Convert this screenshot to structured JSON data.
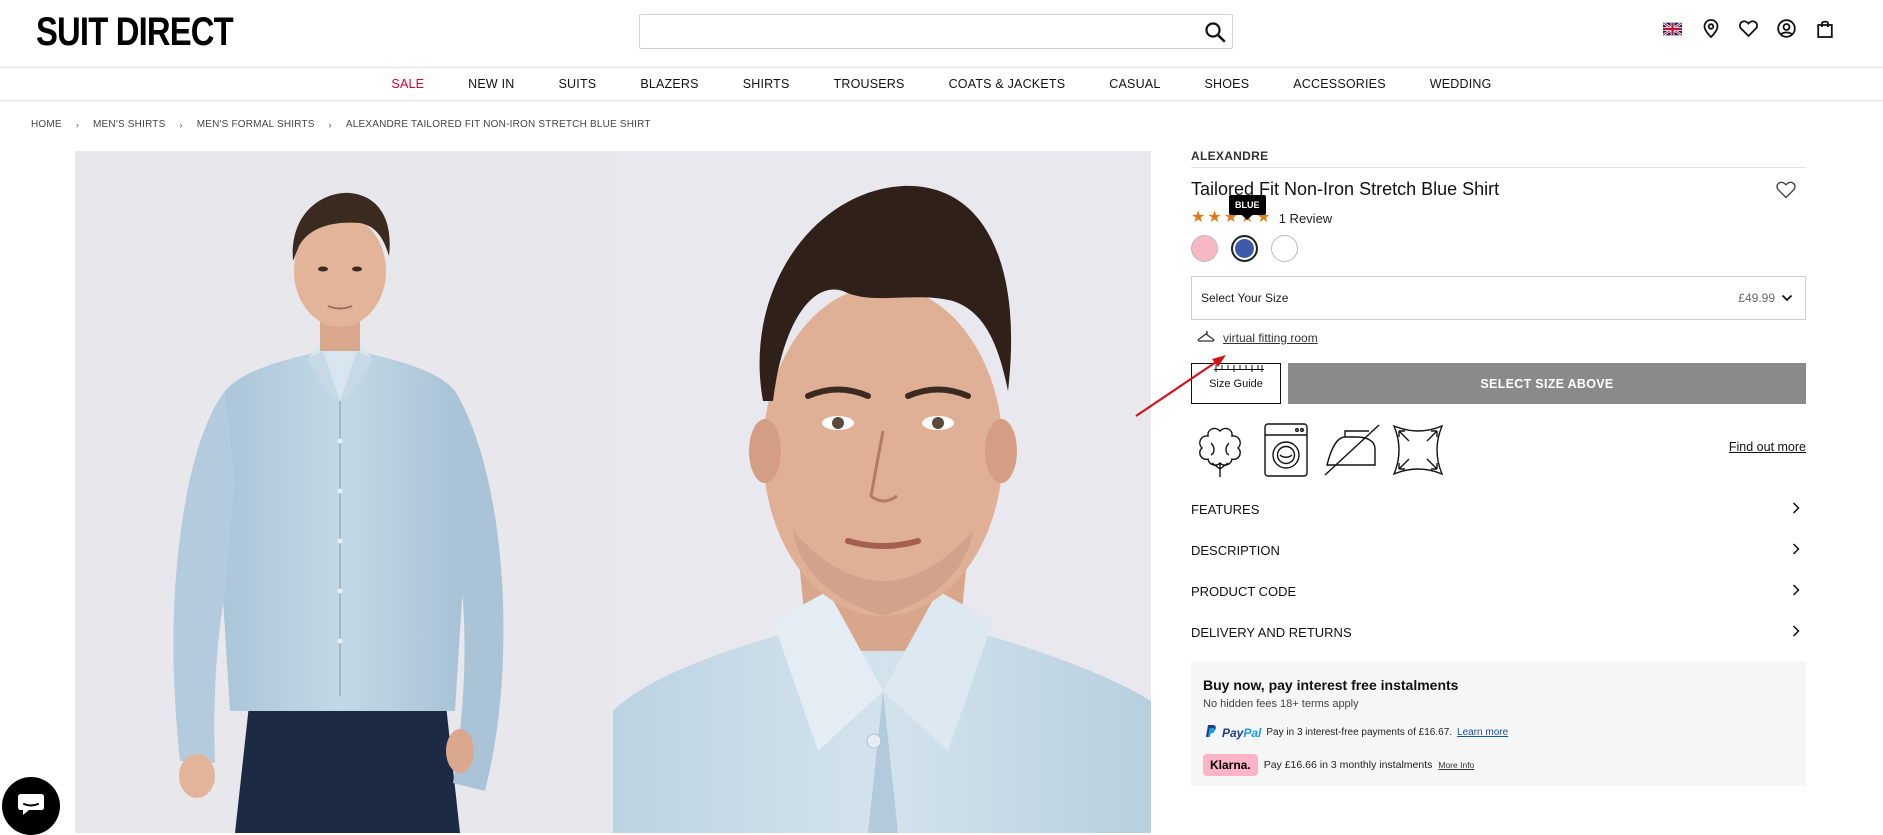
{
  "header": {
    "logo": "SUIT DIRECT",
    "search": {
      "value": "",
      "placeholder": ""
    },
    "icons": [
      "uk-flag-icon",
      "location-icon",
      "heart-icon",
      "account-icon",
      "bag-icon"
    ]
  },
  "nav": {
    "items": [
      {
        "label": "SALE"
      },
      {
        "label": "NEW IN"
      },
      {
        "label": "SUITS"
      },
      {
        "label": "BLAZERS"
      },
      {
        "label": "SHIRTS"
      },
      {
        "label": "TROUSERS"
      },
      {
        "label": "COATS & JACKETS"
      },
      {
        "label": "CASUAL"
      },
      {
        "label": "SHOES"
      },
      {
        "label": "ACCESSORIES"
      },
      {
        "label": "WEDDING"
      }
    ],
    "sale_color": "#d6002a"
  },
  "breadcrumb": {
    "items": [
      "HOME",
      "MEN'S SHIRTS",
      "MEN'S FORMAL SHIRTS",
      "ALEXANDRE TAILORED FIT NON-IRON STRETCH BLUE SHIRT"
    ],
    "separator": "›"
  },
  "product": {
    "brand": "ALEXANDRE",
    "title": "Tailored Fit Non-Iron Stretch Blue Shirt",
    "rating": 5,
    "review_text": "1 Review",
    "tooltip": "BLUE",
    "swatches": [
      {
        "name": "pink",
        "color": "#f7b8c6"
      },
      {
        "name": "blue",
        "color": "#3e5aa8"
      },
      {
        "name": "white",
        "color": "#ffffff"
      }
    ],
    "size_select": {
      "label": "Select Your Size",
      "price": "£49.99"
    },
    "virtual_fitting_room": "virtual fitting room",
    "size_guide": "Size Guide",
    "select_size_button": "SELECT SIZE ABOVE",
    "care_icons": [
      "cotton-icon",
      "machine-wash-icon",
      "no-iron-icon",
      "stretch-icon"
    ],
    "find_out_more": "Find out more",
    "accordion": [
      "FEATURES",
      "DESCRIPTION",
      "PRODUCT CODE",
      "DELIVERY AND RETURNS"
    ]
  },
  "payment": {
    "title": "Buy now, pay interest free instalments",
    "subtitle": "No hidden fees 18+ terms apply",
    "paypal_logo_a": "Pay",
    "paypal_logo_b": "Pal",
    "paypal_text": "Pay in 3 interest-free payments of £16.67.",
    "paypal_link": "Learn more",
    "klarna_logo": "Klarna.",
    "klarna_text": "Pay £16.66 in 3 monthly instalments",
    "klarna_link": "More Info"
  }
}
